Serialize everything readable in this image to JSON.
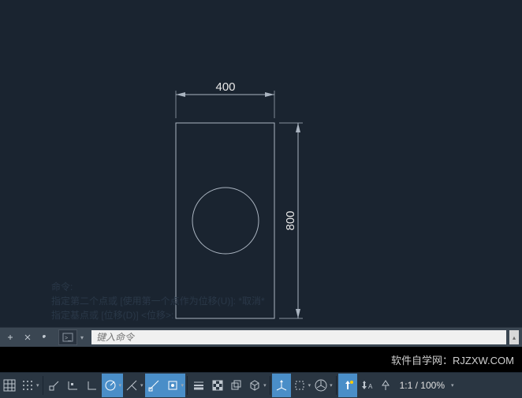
{
  "drawing": {
    "dim_width": "400",
    "dim_height": "800"
  },
  "faded_history": {
    "line1": "命令:",
    "line2": "指定第二个点或 [使用第一个点作为位移(U)]: *取消*",
    "line3": "指定基点或 [位移(D)] <位移>:"
  },
  "command": {
    "placeholder": "键入命令"
  },
  "watermark": "软件自学网：RJZXW.COM",
  "status": {
    "zoom": "1:1 / 100%"
  },
  "icons": {
    "grid": "grid",
    "dots": "dots",
    "snap": "snap",
    "ortho": "ortho",
    "polar": "polar",
    "track": "track",
    "osnap": "osnap",
    "obj_snap": "obj_snap",
    "lineweight": "lineweight",
    "transparency": "transparency",
    "cycle": "cycle",
    "dyn": "dyn",
    "quick": "quick",
    "iso": "iso",
    "nav": "nav",
    "ann": "ann",
    "ann2": "ann2"
  }
}
